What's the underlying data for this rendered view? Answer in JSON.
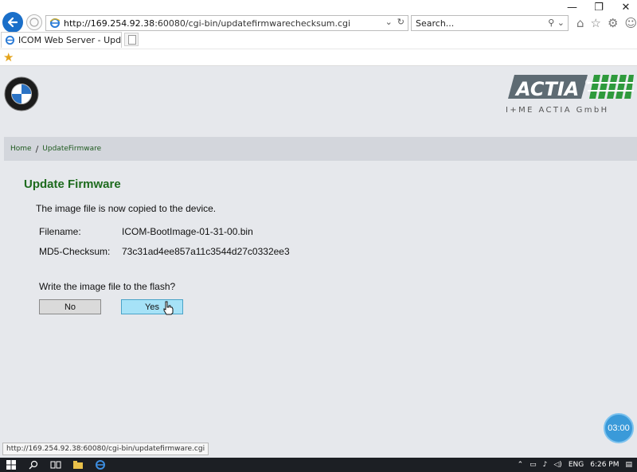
{
  "browser": {
    "url_host": "http://169.254.92.38",
    "url_rest": ":60080/cgi-bin/updatefirmwarechecksum.cgi",
    "search_placeholder": "Search...",
    "tab_title": "ICOM Web Server - Update ...",
    "tab_close": "×",
    "window": {
      "minimize": "—",
      "restore": "❐",
      "close": "✕"
    }
  },
  "page": {
    "actia_subtitle": "I+ME ACTIA GmbH",
    "breadcrumb": {
      "home": "Home",
      "separator": "/",
      "current": "UpdateFirmware"
    },
    "title": "Update Firmware",
    "message": "The image file is now copied to the device.",
    "filename_label": "Filename:",
    "filename_value": "ICOM-BootImage-01-31-00.bin",
    "md5_label": "MD5-Checksum:",
    "md5_value": "73c31ad4ee857a11c3544d27c0332ee3",
    "question": "Write the image file to the flash?",
    "no_label": "No",
    "yes_label": "Yes"
  },
  "overlay": {
    "timer": "03:00",
    "status_url": "http://169.254.92.38:60080/cgi-bin/updatefirmware.cgi"
  },
  "taskbar": {
    "language": "ENG",
    "time": "6:26 PM"
  },
  "colors": {
    "title_green": "#1e6b1e",
    "page_bg": "#e6e8ec",
    "yes_button": "#a6e2f7",
    "ie_blue": "#1a6fc9"
  },
  "icons": [
    "back-arrow-icon",
    "forward-icon",
    "ie-icon",
    "refresh-icon",
    "search-icon",
    "home-icon",
    "favorites-star-icon",
    "settings-gear-icon",
    "smiley-icon",
    "windows-start-icon",
    "search-taskbar-icon",
    "task-view-icon",
    "file-explorer-icon",
    "ie-taskbar-icon"
  ]
}
